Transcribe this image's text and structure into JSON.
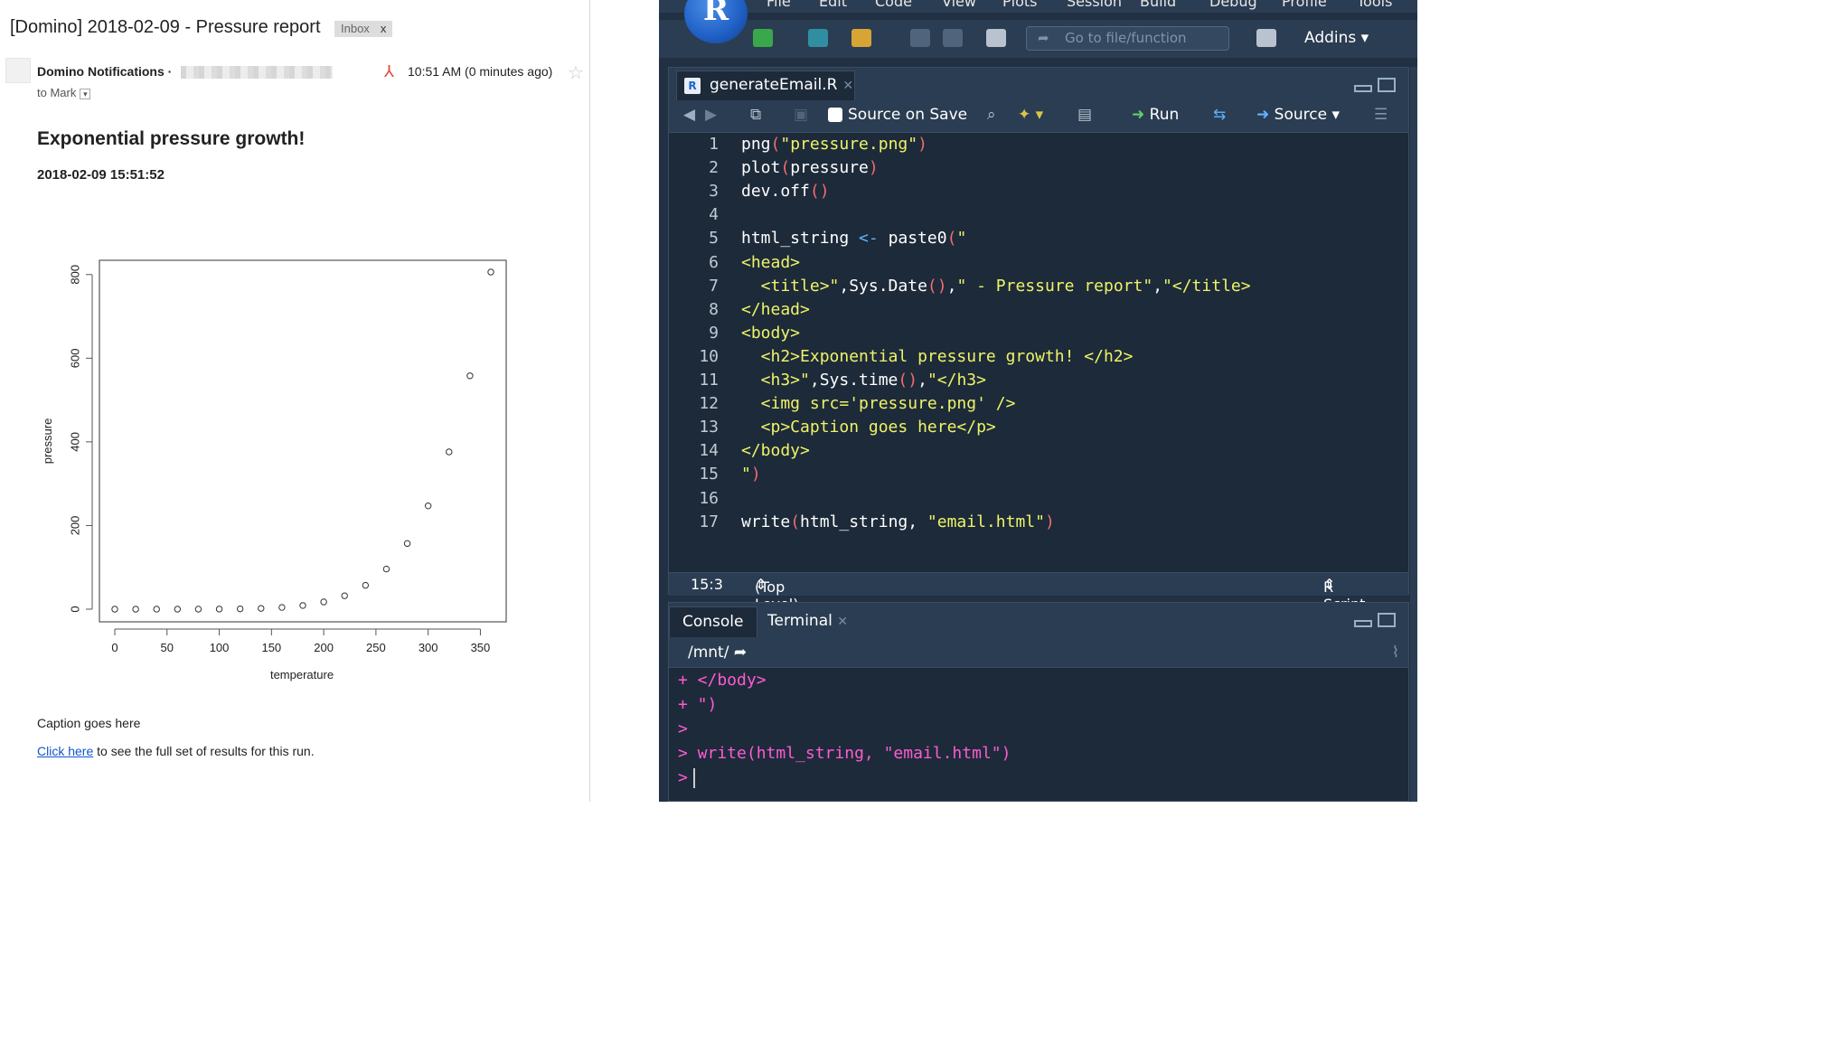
{
  "email": {
    "subject": "[Domino] 2018-02-09 - Pressure report",
    "label_inbox": "Inbox",
    "label_close": "x",
    "sender": "Domino Notifications",
    "sender_sep": "·",
    "to": "to Mark",
    "time": "10:51 AM (0 minutes ago)",
    "heading": "Exponential pressure growth!",
    "timestamp": "2018-02-09 15:51:52",
    "caption": "Caption goes here",
    "link_text": "Click here",
    "link_rest": " to see the full set of results for this run."
  },
  "chart_data": {
    "type": "scatter",
    "title": "",
    "xlabel": "temperature",
    "ylabel": "pressure",
    "xlim": [
      0,
      360
    ],
    "ylim": [
      0,
      806
    ],
    "xticks": [
      0,
      50,
      100,
      150,
      200,
      250,
      300,
      350
    ],
    "yticks": [
      0,
      200,
      400,
      600,
      800
    ],
    "x": [
      0,
      20,
      40,
      60,
      80,
      100,
      120,
      140,
      160,
      180,
      200,
      220,
      240,
      260,
      280,
      300,
      320,
      340,
      360
    ],
    "y": [
      0.0002,
      0.0012,
      0.006,
      0.03,
      0.09,
      0.27,
      0.75,
      1.85,
      4.2,
      8.8,
      17.3,
      32.1,
      57,
      96,
      157,
      247,
      376,
      558,
      806
    ],
    "grid": false,
    "legend": "none"
  },
  "rstudio": {
    "menu": [
      "File",
      "Edit",
      "Code",
      "View",
      "Plots",
      "Session",
      "Build",
      "Debug",
      "Profile",
      "Tools"
    ],
    "logo": "R",
    "goto_placeholder": "Go to file/function",
    "addins": "Addins",
    "file_tab": "generateEmail.R",
    "source_on_save": "Source on Save",
    "run": "Run",
    "source": "Source",
    "code_lines": [
      {
        "n": "1",
        "segs": [
          [
            "png",
            ""
          ],
          [
            "(",
            "par"
          ],
          [
            "\"pressure.png\"",
            "str"
          ],
          [
            ")",
            "par"
          ]
        ]
      },
      {
        "n": "2",
        "segs": [
          [
            "plot",
            ""
          ],
          [
            "(",
            "par"
          ],
          [
            "pressure",
            ""
          ],
          [
            ")",
            "par"
          ]
        ]
      },
      {
        "n": "3",
        "segs": [
          [
            "dev.off",
            ""
          ],
          [
            "(",
            "par"
          ],
          [
            ")",
            "par"
          ]
        ]
      },
      {
        "n": "4",
        "segs": []
      },
      {
        "n": "5",
        "segs": [
          [
            "html_string ",
            ""
          ],
          [
            "<-",
            "ops"
          ],
          [
            " paste0",
            ""
          ],
          [
            "(",
            "par"
          ],
          [
            "\"",
            "str"
          ]
        ]
      },
      {
        "n": "6",
        "segs": [
          [
            "<head>",
            "str"
          ]
        ]
      },
      {
        "n": "7",
        "segs": [
          [
            "  <title>\"",
            "str"
          ],
          [
            ",Sys.Date",
            ""
          ],
          [
            "(",
            "par"
          ],
          [
            ")",
            "par"
          ],
          [
            ",",
            ""
          ],
          [
            "\" - Pressure report\"",
            "str"
          ],
          [
            ",",
            ""
          ],
          [
            "\"</title>",
            "str"
          ]
        ]
      },
      {
        "n": "8",
        "segs": [
          [
            "</head>",
            "str"
          ]
        ]
      },
      {
        "n": "9",
        "segs": [
          [
            "<body>",
            "str"
          ]
        ]
      },
      {
        "n": "10",
        "segs": [
          [
            "  <h2>Exponential pressure growth! </h2>",
            "str"
          ]
        ]
      },
      {
        "n": "11",
        "segs": [
          [
            "  <h3>\"",
            "str"
          ],
          [
            ",Sys.time",
            ""
          ],
          [
            "(",
            "par"
          ],
          [
            ")",
            "par"
          ],
          [
            ",",
            ""
          ],
          [
            "\"</h3>",
            "str"
          ]
        ]
      },
      {
        "n": "12",
        "segs": [
          [
            "  <img src='pressure.png' />",
            "str"
          ]
        ]
      },
      {
        "n": "13",
        "segs": [
          [
            "  <p>Caption goes here</p>",
            "str"
          ]
        ]
      },
      {
        "n": "14",
        "segs": [
          [
            "</body>",
            "str"
          ]
        ]
      },
      {
        "n": "15",
        "segs": [
          [
            "\"",
            "str"
          ],
          [
            ")",
            "par"
          ]
        ]
      },
      {
        "n": "16",
        "segs": []
      },
      {
        "n": "17",
        "segs": [
          [
            "write",
            ""
          ],
          [
            "(",
            "par"
          ],
          [
            "html_string, ",
            ""
          ],
          [
            "\"email.html\"",
            "str"
          ],
          [
            ")",
            "par"
          ]
        ]
      }
    ],
    "status_pos": "15:3",
    "status_scope": "(Top Level)",
    "status_type": "R Script",
    "console_tab": "Console",
    "terminal_tab": "Terminal",
    "console_path": "/mnt/",
    "console_lines": [
      "+ </body>",
      "+ \")",
      ">",
      "> write(html_string, \"email.html\")",
      ">"
    ]
  }
}
